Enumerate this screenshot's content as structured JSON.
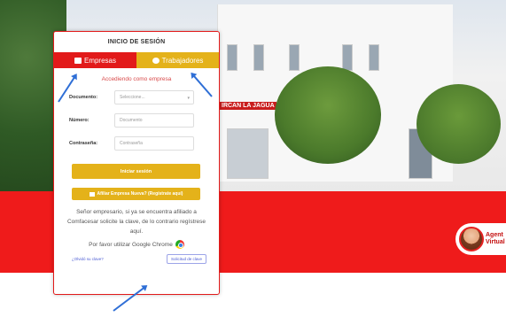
{
  "card": {
    "title": "INICIO DE SESIÓN",
    "tabs": [
      {
        "label": "Empresas"
      },
      {
        "label": "Trabajadores"
      }
    ],
    "subtitle": "Accediendo como empresa",
    "fields": {
      "documento_label": "Documento:",
      "documento_value": "Seleccione...",
      "numero_label": "Número:",
      "numero_placeholder": "Documento",
      "password_label": "Contraseña:",
      "password_placeholder": "Contraseña"
    },
    "login_button": "Iniciar sesión",
    "afiliar_button": "Afiliar Empresa Nueva? (Regístrate aquí)",
    "info_text": "Señor empresario, si ya se encuentra afiliado a Comfacesar solicite la clave, de lo contrario regístrese aquí.",
    "chrome_text": "Por favor utilizar Google Chrome",
    "forgot_link": "¿Olvidó su clave?",
    "solicitud_button": "Solicitud de clave"
  },
  "agent": {
    "label_line1": "Agent",
    "label_line2": "Virtual"
  },
  "sign": {
    "text": "IRCAN LA JAGUA"
  },
  "colors": {
    "red": "#e21a1a",
    "yellow": "#e4b21a",
    "arrow": "#2f6fd6"
  }
}
